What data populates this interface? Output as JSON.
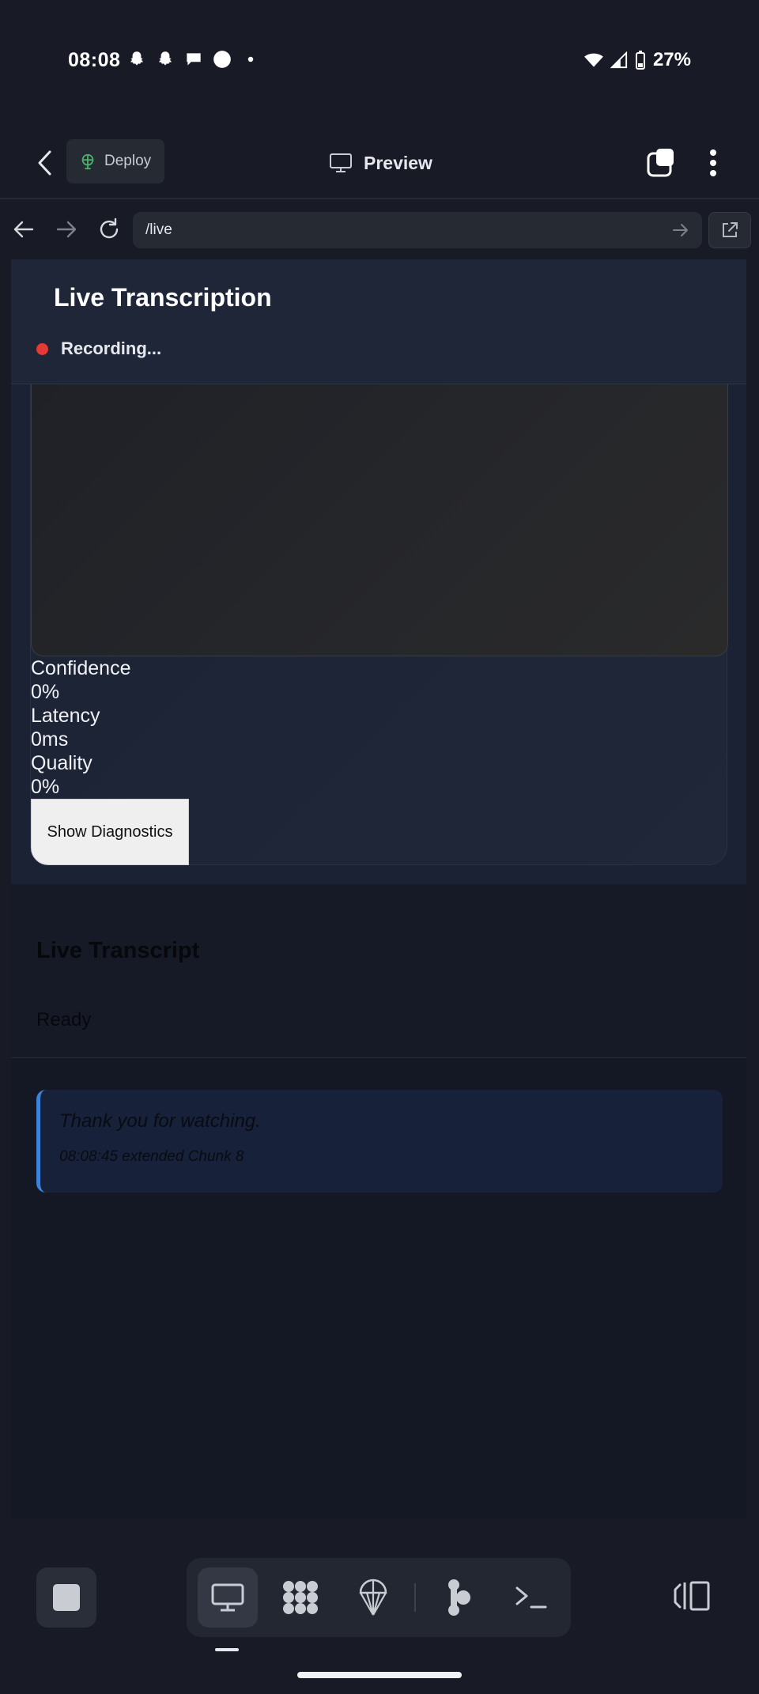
{
  "status_bar": {
    "time": "08:08",
    "battery": "27%",
    "notification_icons": [
      "snapchat-icon",
      "snapchat-icon",
      "chat-icon",
      "circle-icon",
      "dot-icon"
    ]
  },
  "toolbar": {
    "deploy_label": "Deploy",
    "preview_label": "Preview"
  },
  "url_bar": {
    "url": "/live"
  },
  "page": {
    "title": "Live Transcription",
    "recording_status": "Recording...",
    "stats": {
      "confidence_label": "Confidence",
      "confidence_value": "0%",
      "latency_label": "Latency",
      "latency_value": "0ms",
      "quality_label": "Quality",
      "quality_value": "0%"
    },
    "diagnostics_button": "Show Diagnostics",
    "transcript": {
      "title": "Live Transcript",
      "status": "Ready",
      "entries": [
        {
          "text": "Thank you for watching.",
          "meta": "08:08:45 extended Chunk 8"
        }
      ]
    }
  },
  "bottom_nav": {
    "items": [
      "preview-icon",
      "apps-icon",
      "deploy-icon",
      "agent-icon",
      "terminal-icon"
    ],
    "active": "preview-icon"
  },
  "colors": {
    "accent": "#3b82d8",
    "recording": "#e53935",
    "deploy_green": "#4caf6a"
  }
}
